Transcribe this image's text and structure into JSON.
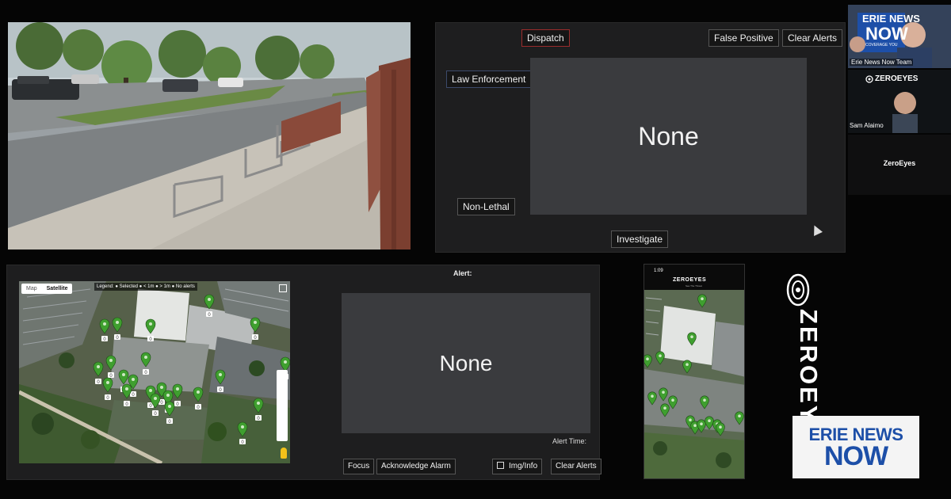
{
  "colors": {
    "panel": "#3a3b3e",
    "console_bg": "#1e1e1f",
    "pin_green": "#3f9f2f",
    "dispatch_border": "#9a2c2c",
    "brand_blue": "#1d4fa8"
  },
  "console": {
    "dispatch_label": "Dispatch",
    "false_positive_label": "False Positive",
    "clear_alerts_label": "Clear Alerts",
    "law_enforcement_label": "Law Enforcement",
    "non_lethal_label": "Non-Lethal",
    "investigate_label": "Investigate",
    "panel_text": "None"
  },
  "dashboard": {
    "map_tabs": [
      "Map",
      "Satellite"
    ],
    "legend": "Legend: ● Selected  ● < 1m  ● > 1m  ● No alerts",
    "alert_label": "Alert:",
    "panel_text": "None",
    "alert_time_label": "Alert Time:",
    "focus_label": "Focus",
    "acknowledge_label": "Acknowledge Alarm",
    "img_info_label": "Img/Info",
    "clear_alerts_label": "Clear Alerts",
    "pin_count": "0"
  },
  "phone": {
    "time": "1:09",
    "logo": "ZEROEYES",
    "tagline": "See The Threat"
  },
  "brand": {
    "vertical_name": "ZEROEYES"
  },
  "video_call": {
    "tile1_name": "Erie News Now Team",
    "tile1_badge_top": "ERIE NEWS",
    "tile1_badge_bottom": "NOW",
    "tile1_badge_sub": "COVERAGE YOU",
    "tile2_logo": "ZEROEYES",
    "tile2_name": "Sam Alaimo",
    "tile3_name": "ZeroEyes"
  },
  "watermark": {
    "line1": "ERIE NEWS",
    "line2": "NOW"
  }
}
